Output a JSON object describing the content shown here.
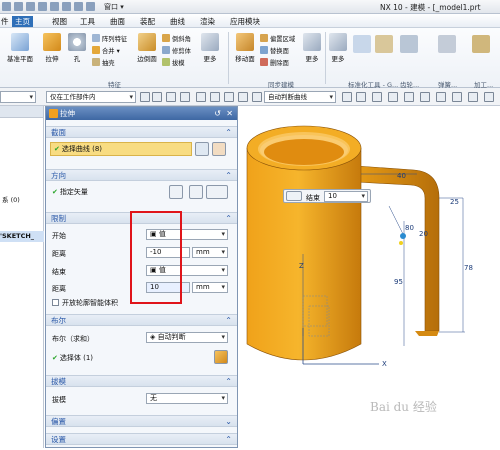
{
  "titlebar": {
    "window_menu": "窗口",
    "title": "NX 10 - 建模 - [_model1.prt"
  },
  "menu": [
    "件",
    "主页",
    "视图",
    "工具",
    "曲面",
    "装配",
    "曲线",
    "渲染",
    "应用模块"
  ],
  "ribbon": {
    "sketch_plane": "基准平面",
    "extrude": "拉伸",
    "hole": "孔",
    "pattern_feature": "阵列特征",
    "unite": "合并",
    "shell": "抽壳",
    "edge_blend": "边倒圆",
    "chamfer": "倒斜角",
    "trim_body": "修剪体",
    "draft": "拔模",
    "more1": "更多",
    "feature_group": "特征",
    "offset_region": "偏置区域",
    "replace_face": "替换面",
    "delete_face": "删除面",
    "move_face": "移动面",
    "more2": "更多",
    "sync_group": "同步建模",
    "more3": "更多",
    "std_group": "标准化工具 - G...",
    "gear_group": "齿轮...",
    "spring_group": "弹簧...",
    "process_group": "加工..."
  },
  "toolbar2": {
    "filter_combo": "仅在工作部件内",
    "curve_rule": "自动判断曲线"
  },
  "leftnav": {
    "row1": "系 (0)",
    "row2": "'SKETCH_"
  },
  "dialog": {
    "title": "拉伸",
    "sec_section": "截面",
    "select_curve": "选择曲线 (8)",
    "sec_direction": "方向",
    "specify_vector": "指定矢量",
    "sec_limits": "限制",
    "start_label": "开始",
    "start_value": "值",
    "distance_label1": "距离",
    "distance_value1": "-10",
    "unit1": "mm",
    "end_label": "结束",
    "end_value": "值",
    "distance_label2": "距离",
    "distance_value2": "10",
    "unit2": "mm",
    "open_profile": "开放轮廓智能体积",
    "sec_boolean": "布尔",
    "boolean_label": "布尔（求和）",
    "boolean_value": "自动判断",
    "select_body": "选择体 (1)",
    "sec_draft": "拔模",
    "draft_label": "拔模",
    "draft_value": "无",
    "sec_offset": "偏置",
    "sec_settings": "设置"
  },
  "floatbar": {
    "end_label": "结束",
    "end_value": "10"
  },
  "dims": {
    "d40": "40",
    "d25": "25",
    "d20": "20",
    "d80": "80",
    "d78": "78",
    "d95": "95",
    "x_axis": "X",
    "z_axis": "Z"
  },
  "watermark": "Bai du 经验"
}
